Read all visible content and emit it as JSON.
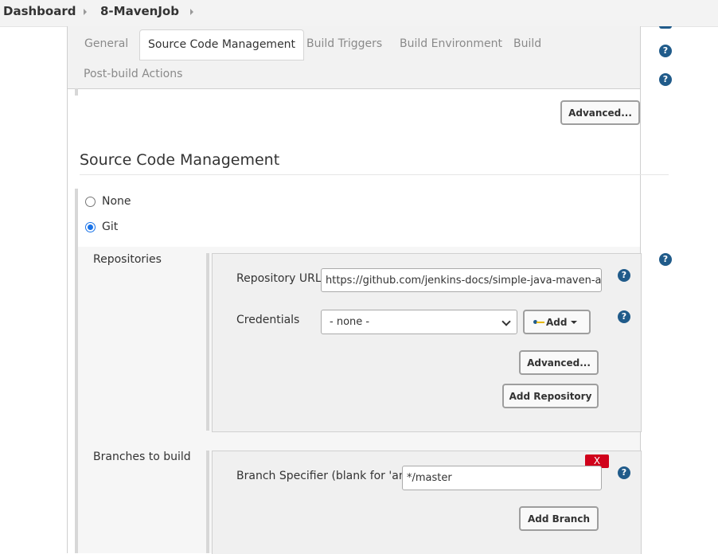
{
  "breadcrumb": {
    "dashboard": "Dashboard",
    "job": "8-MavenJob"
  },
  "tabs": [
    {
      "label": "General"
    },
    {
      "label": "Source Code Management"
    },
    {
      "label": "Build Triggers"
    },
    {
      "label": "Build Environment"
    },
    {
      "label": "Build"
    },
    {
      "label": "Post-build Actions"
    }
  ],
  "top_advanced_label": "Advanced...",
  "scm": {
    "title": "Source Code Management",
    "options": [
      {
        "label": "None",
        "checked": false
      },
      {
        "label": "Git",
        "checked": true
      }
    ],
    "repositories": {
      "label": "Repositories",
      "repo_url_label": "Repository URL",
      "repo_url_value": "https://github.com/jenkins-docs/simple-java-maven-app",
      "credentials_label": "Credentials",
      "credentials_value": "- none -",
      "add_label": "Add",
      "advanced_label": "Advanced...",
      "add_repository_label": "Add Repository"
    },
    "branches": {
      "label": "Branches to build",
      "delete_label": "X",
      "branch_spec_label": "Branch Specifier (blank for 'any')",
      "branch_spec_value": "*/master",
      "add_branch_label": "Add Branch"
    }
  },
  "help_glyph": "?",
  "colors": {
    "help": "#205b8a",
    "delete": "#d0021b",
    "radio_checked": "#1a73e8"
  }
}
